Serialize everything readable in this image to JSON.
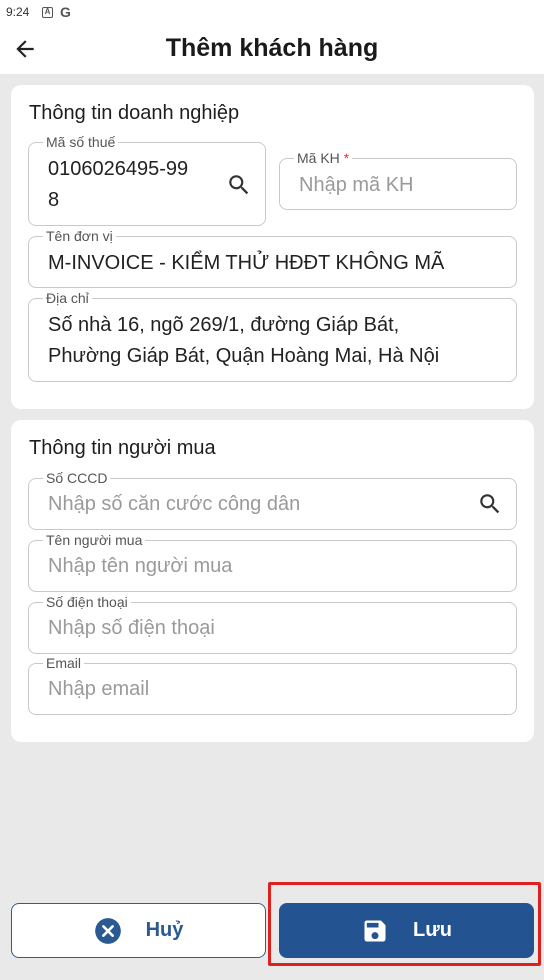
{
  "status_bar": {
    "time": "9:24",
    "icon_a": "A",
    "icon_g": "G"
  },
  "header": {
    "title": "Thêm khách hàng"
  },
  "business_info": {
    "section_title": "Thông tin doanh nghiệp",
    "tax_code": {
      "label": "Mã số thuế",
      "value_line1": "0106026495-99",
      "value_line2": "8"
    },
    "customer_code": {
      "label": "Mã KH",
      "required_mark": "*",
      "placeholder": "Nhập mã KH"
    },
    "unit_name": {
      "label": "Tên đơn vị",
      "value": "M-INVOICE - KIỂM THỬ HĐĐT KHÔNG MÃ"
    },
    "address": {
      "label": "Địa chỉ",
      "value_line1": "Số nhà 16, ngõ 269/1, đường Giáp Bát,",
      "value_line2": "Phường Giáp Bát, Quận Hoàng Mai, Hà Nội"
    }
  },
  "buyer_info": {
    "section_title": "Thông tin người mua",
    "id_card": {
      "label": "Số CCCD",
      "placeholder": "Nhập số căn cước công dân"
    },
    "buyer_name": {
      "label": "Tên người mua",
      "placeholder": "Nhập tên người mua"
    },
    "phone": {
      "label": "Số điện thoại",
      "placeholder": "Nhập số điện thoại"
    },
    "email": {
      "label": "Email",
      "placeholder": "Nhập email"
    }
  },
  "actions": {
    "cancel_label": "Huỷ",
    "save_label": "Lưu"
  },
  "colors": {
    "primary": "#245391",
    "required": "#e53935",
    "highlight": "#e01f1f"
  }
}
